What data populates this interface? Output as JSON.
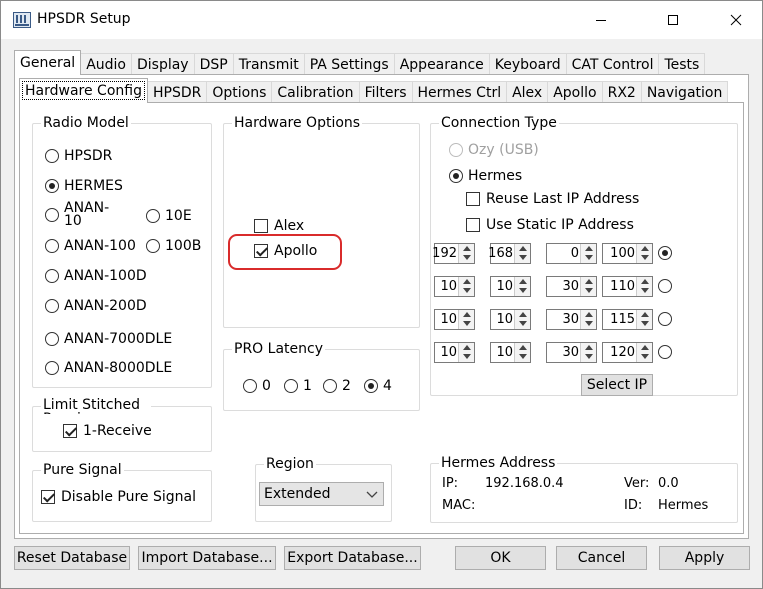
{
  "window": {
    "title": "HPSDR Setup"
  },
  "tabs_main": [
    "General",
    "Audio",
    "Display",
    "DSP",
    "Transmit",
    "PA Settings",
    "Appearance",
    "Keyboard",
    "CAT Control",
    "Tests"
  ],
  "tabs_sub": [
    "Hardware Config",
    "HPSDR",
    "Options",
    "Calibration",
    "Filters",
    "Hermes Ctrl",
    "Alex",
    "Apollo",
    "RX2",
    "Navigation"
  ],
  "radio_model": {
    "title": "Radio Model",
    "options": [
      "HPSDR",
      "HERMES",
      "ANAN-\n10",
      "10E",
      "ANAN-100",
      "100B",
      "ANAN-100D",
      "ANAN-200D",
      "ANAN-7000DLE",
      "ANAN-8000DLE"
    ],
    "selected": "HERMES"
  },
  "hardware_options": {
    "title": "Hardware Options",
    "alex": "Alex",
    "apollo": "Apollo",
    "alex_checked": false,
    "apollo_checked": true
  },
  "pro_latency": {
    "title": "PRO Latency",
    "options": [
      "0",
      "1",
      "2",
      "4"
    ],
    "selected": "4"
  },
  "stitched": {
    "title": "Limit Stitched Receivers",
    "checkbox": "1-Receive",
    "checked": true
  },
  "pure_signal": {
    "title": "Pure Signal",
    "checkbox": "Disable Pure Signal",
    "checked": true
  },
  "region": {
    "title": "Region",
    "value": "Extended"
  },
  "connection": {
    "title": "Connection Type",
    "ozy": "Ozy (USB)",
    "hermes": "Hermes",
    "reuse": "Reuse Last IP Address",
    "static": "Use Static IP Address",
    "ip_rows": [
      [
        "192",
        "168",
        "0",
        "100"
      ],
      [
        "10",
        "10",
        "30",
        "110"
      ],
      [
        "10",
        "10",
        "30",
        "115"
      ],
      [
        "10",
        "10",
        "30",
        "120"
      ]
    ],
    "selected_row": 0,
    "select_ip": "Select IP"
  },
  "hermes_address": {
    "title": "Hermes Address",
    "ip_label": "IP:",
    "ip": "192.168.0.4",
    "mac_label": "MAC:",
    "ver_label": "Ver:",
    "ver": "0.0",
    "id_label": "ID:",
    "id": "Hermes"
  },
  "buttons": {
    "reset": "Reset Database",
    "import": "Import Database...",
    "export": "Export Database...",
    "ok": "OK",
    "cancel": "Cancel",
    "apply": "Apply"
  },
  "colors": {
    "highlight": "#d92b2b"
  }
}
